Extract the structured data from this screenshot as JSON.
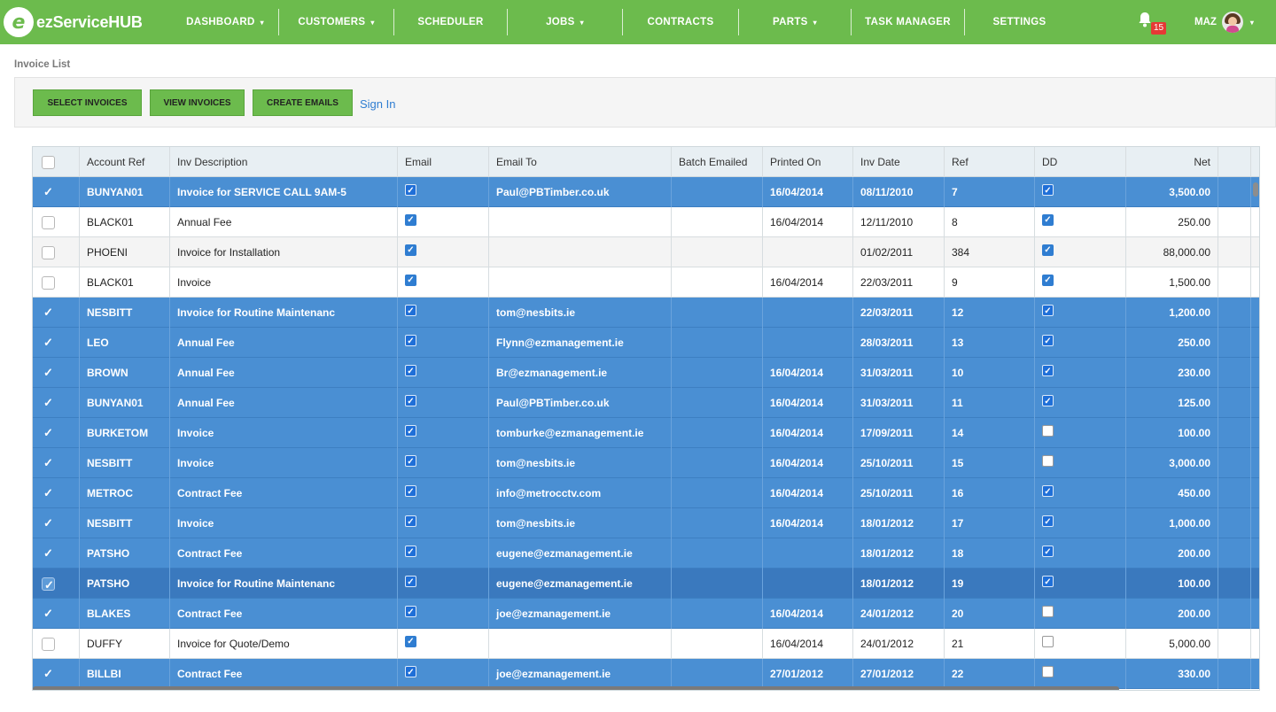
{
  "brand": {
    "logo_letter": "e",
    "name": "ezServiceHUB"
  },
  "nav": [
    {
      "label": "DASHBOARD",
      "caret": "▾"
    },
    {
      "label": "CUSTOMERS",
      "caret": "▾"
    },
    {
      "label": "SCHEDULER",
      "caret": ""
    },
    {
      "label": "JOBS",
      "caret": "▾"
    },
    {
      "label": "CONTRACTS",
      "caret": ""
    },
    {
      "label": "PARTS",
      "caret": "▾"
    },
    {
      "label": "TASK MANAGER",
      "caret": ""
    },
    {
      "label": "SETTINGS",
      "caret": ""
    }
  ],
  "notifications": {
    "count": "15"
  },
  "user": {
    "name": "MAZ",
    "caret": "▾"
  },
  "page": {
    "title": "Invoice List"
  },
  "toolbar": {
    "select_invoices": "SELECT INVOICES",
    "view_invoices": "VIEW INVOICES",
    "create_emails": "CREATE EMAILS",
    "sign_in": "Sign In"
  },
  "table": {
    "columns": [
      "Account Ref",
      "Inv Description",
      "Email",
      "Email To",
      "Batch Emailed",
      "Printed On",
      "Inv Date",
      "Ref",
      "DD",
      "Net"
    ],
    "rows": [
      {
        "selected": true,
        "account_ref": "BUNYAN01",
        "inv_description": "Invoice for SERVICE CALL 9AM-5",
        "email": true,
        "email_to": "Paul@PBTimber.co.uk",
        "batch_emailed": "",
        "printed_on": "16/04/2014",
        "inv_date": "08/11/2010",
        "ref": "7",
        "dd": true,
        "net": "3,500.00"
      },
      {
        "selected": false,
        "account_ref": "BLACK01",
        "inv_description": "Annual Fee",
        "email": true,
        "email_to": "",
        "batch_emailed": "",
        "printed_on": "16/04/2014",
        "inv_date": "12/11/2010",
        "ref": "8",
        "dd": true,
        "net": "250.00"
      },
      {
        "selected": false,
        "account_ref": "PHOENI",
        "inv_description": "Invoice for Installation",
        "email": true,
        "email_to": "",
        "batch_emailed": "",
        "printed_on": "",
        "inv_date": "01/02/2011",
        "ref": "384",
        "dd": true,
        "net": "88,000.00"
      },
      {
        "selected": false,
        "account_ref": "BLACK01",
        "inv_description": "Invoice",
        "email": true,
        "email_to": "",
        "batch_emailed": "",
        "printed_on": "16/04/2014",
        "inv_date": "22/03/2011",
        "ref": "9",
        "dd": true,
        "net": "1,500.00"
      },
      {
        "selected": true,
        "account_ref": "NESBITT",
        "inv_description": "Invoice for Routine Maintenanc",
        "email": true,
        "email_to": "tom@nesbits.ie",
        "batch_emailed": "",
        "printed_on": "",
        "inv_date": "22/03/2011",
        "ref": "12",
        "dd": true,
        "net": "1,200.00"
      },
      {
        "selected": true,
        "account_ref": "LEO",
        "inv_description": "Annual Fee",
        "email": true,
        "email_to": "Flynn@ezmanagement.ie",
        "batch_emailed": "",
        "printed_on": "",
        "inv_date": "28/03/2011",
        "ref": "13",
        "dd": true,
        "net": "250.00"
      },
      {
        "selected": true,
        "account_ref": "BROWN",
        "inv_description": "Annual Fee",
        "email": true,
        "email_to": "Br@ezmanagement.ie",
        "batch_emailed": "",
        "printed_on": "16/04/2014",
        "inv_date": "31/03/2011",
        "ref": "10",
        "dd": true,
        "net": "230.00"
      },
      {
        "selected": true,
        "account_ref": "BUNYAN01",
        "inv_description": "Annual Fee",
        "email": true,
        "email_to": "Paul@PBTimber.co.uk",
        "batch_emailed": "",
        "printed_on": "16/04/2014",
        "inv_date": "31/03/2011",
        "ref": "11",
        "dd": true,
        "net": "125.00"
      },
      {
        "selected": true,
        "account_ref": "BURKETOM",
        "inv_description": "Invoice",
        "email": true,
        "email_to": "tomburke@ezmanagement.ie",
        "batch_emailed": "",
        "printed_on": "16/04/2014",
        "inv_date": "17/09/2011",
        "ref": "14",
        "dd": false,
        "net": "100.00"
      },
      {
        "selected": true,
        "account_ref": "NESBITT",
        "inv_description": "Invoice",
        "email": true,
        "email_to": "tom@nesbits.ie",
        "batch_emailed": "",
        "printed_on": "16/04/2014",
        "inv_date": "25/10/2011",
        "ref": "15",
        "dd": false,
        "net": "3,000.00"
      },
      {
        "selected": true,
        "account_ref": "METROC",
        "inv_description": "Contract Fee",
        "email": true,
        "email_to": "info@metrocctv.com",
        "batch_emailed": "",
        "printed_on": "16/04/2014",
        "inv_date": "25/10/2011",
        "ref": "16",
        "dd": true,
        "net": "450.00"
      },
      {
        "selected": true,
        "account_ref": "NESBITT",
        "inv_description": "Invoice",
        "email": true,
        "email_to": "tom@nesbits.ie",
        "batch_emailed": "",
        "printed_on": "16/04/2014",
        "inv_date": "18/01/2012",
        "ref": "17",
        "dd": true,
        "net": "1,000.00"
      },
      {
        "selected": true,
        "account_ref": "PATSHO",
        "inv_description": "Contract Fee",
        "email": true,
        "email_to": "eugene@ezmanagement.ie",
        "batch_emailed": "",
        "printed_on": "",
        "inv_date": "18/01/2012",
        "ref": "18",
        "dd": true,
        "net": "200.00"
      },
      {
        "selected": true,
        "active": true,
        "account_ref": "PATSHO",
        "inv_description": "Invoice for Routine Maintenanc",
        "email": true,
        "email_to": "eugene@ezmanagement.ie",
        "batch_emailed": "",
        "printed_on": "",
        "inv_date": "18/01/2012",
        "ref": "19",
        "dd": true,
        "net": "100.00"
      },
      {
        "selected": true,
        "account_ref": "BLAKES",
        "inv_description": "Contract Fee",
        "email": true,
        "email_to": "joe@ezmanagement.ie",
        "batch_emailed": "",
        "printed_on": "16/04/2014",
        "inv_date": "24/01/2012",
        "ref": "20",
        "dd": false,
        "net": "200.00"
      },
      {
        "selected": false,
        "account_ref": "DUFFY",
        "inv_description": "Invoice for Quote/Demo",
        "email": true,
        "email_to": "",
        "batch_emailed": "",
        "printed_on": "16/04/2014",
        "inv_date": "24/01/2012",
        "ref": "21",
        "dd": false,
        "net": "5,000.00"
      },
      {
        "selected": true,
        "account_ref": "BILLBI",
        "inv_description": "Contract Fee",
        "email": true,
        "email_to": "joe@ezmanagement.ie",
        "batch_emailed": "",
        "printed_on": "27/01/2012",
        "inv_date": "27/01/2012",
        "ref": "22",
        "dd": false,
        "net": "330.00"
      }
    ]
  },
  "icons": {
    "bell": "bell-icon",
    "check": "check-icon",
    "caret": "chevron-down-icon"
  },
  "colors": {
    "brand_green": "#6cbb4d",
    "selected_row": "#4a8fd3",
    "active_row": "#3a79be",
    "link": "#2f7dd1",
    "badge": "#e53935"
  }
}
